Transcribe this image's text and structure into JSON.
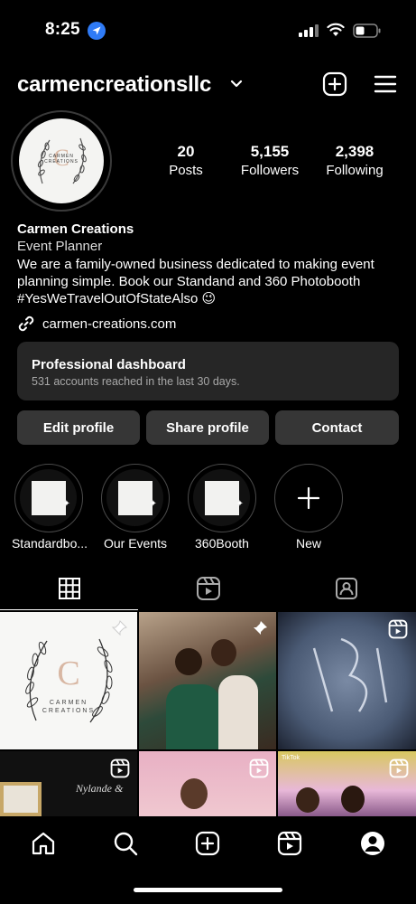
{
  "status_bar": {
    "time": "8:25"
  },
  "header": {
    "username": "carmencreationsllc"
  },
  "stats": [
    {
      "value": "20",
      "label": "Posts"
    },
    {
      "value": "5,155",
      "label": "Followers"
    },
    {
      "value": "2,398",
      "label": "Following"
    }
  ],
  "bio": {
    "name": "Carmen Creations",
    "category": "Event Planner",
    "line1": "We are a family-owned business dedicated to making event",
    "line2": "planning simple. Book our Standand and 360 Photobooth",
    "line3": "#YesWeTravelOutOfStateAlso 😉",
    "link": "carmen-creations.com"
  },
  "dashboard": {
    "title": "Professional dashboard",
    "subtitle": "531 accounts reached in the last 30 days."
  },
  "buttons": {
    "edit": "Edit profile",
    "share": "Share profile",
    "contact": "Contact"
  },
  "highlights": [
    {
      "label": "Standardbo..."
    },
    {
      "label": "Our Events"
    },
    {
      "label": "360Booth"
    },
    {
      "label": "New"
    }
  ],
  "logo": {
    "line1": "CARMEN",
    "line2": "CREATIONS"
  },
  "posts": {
    "tiktok_badge": "TikTok",
    "names_overlay": "Nylande &"
  }
}
